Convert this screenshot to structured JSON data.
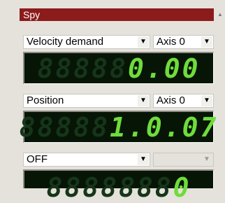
{
  "panel": {
    "title": "Spy",
    "scroll_icon": "scroll-up-arrow-icon"
  },
  "rows": [
    {
      "signal": "Velocity demand",
      "axis": "Axis 0",
      "display": {
        "dim": "88888",
        "lit": "0.00"
      }
    },
    {
      "signal": "Position",
      "axis": "Axis 0",
      "display": {
        "dim": "88888",
        "lit": "1.0.07"
      }
    },
    {
      "signal": "OFF",
      "axis": "",
      "display": {
        "dim": "8888888",
        "lit": "0"
      }
    }
  ],
  "colors": {
    "title_bar": "#8c1b1b",
    "panel_bg": "#e5e2dc",
    "display_bg": "#061506",
    "digit_lit": "#6fdc3c",
    "digit_unlit": "#16351a"
  }
}
